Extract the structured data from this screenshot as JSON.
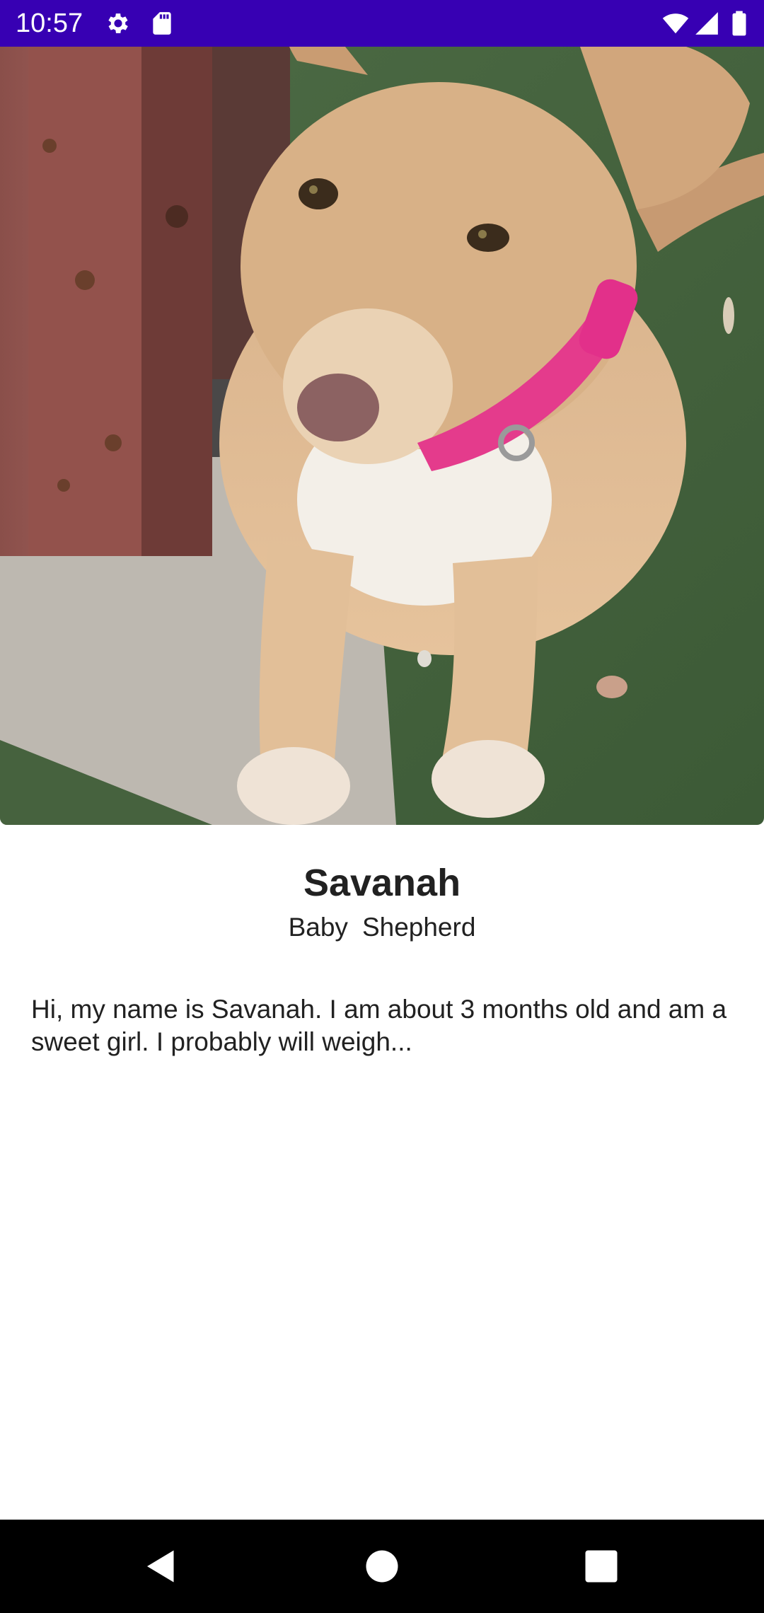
{
  "status_bar": {
    "time": "10:57",
    "background": "#3700b3",
    "left_icons": [
      "settings-icon",
      "sd-card-icon"
    ],
    "right_icons": [
      "wifi-icon",
      "signal-icon",
      "battery-icon"
    ]
  },
  "pet": {
    "name": "Savanah",
    "age": "Baby",
    "breed": "Shepherd",
    "description": "Hi, my name is Savanah. I am about 3 months old and am a sweet girl. I probably will weigh..."
  },
  "nav_bar": {
    "buttons": [
      "back-icon",
      "home-icon",
      "recents-icon"
    ]
  }
}
